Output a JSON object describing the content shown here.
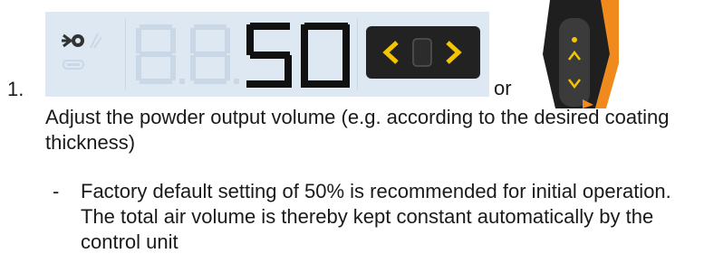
{
  "step": {
    "number": "1."
  },
  "panel": {
    "display_value": "50",
    "ghost_digits": "8.8."
  },
  "or_label": "or",
  "instruction": "Adjust the powder output volume (e.g. according to the desired coating thickness)",
  "note": {
    "bullet": "-",
    "text": "Factory default setting of 50% is recommended for initial operation. The total air volume is thereby kept constant automatically by the control unit"
  },
  "colors": {
    "panel_bg": "#dde8f3",
    "segment_active": "#111111",
    "segment_ghost": "#c9d7e6",
    "arrow_accent": "#f5c400",
    "handle_orange": "#f08a1c"
  }
}
